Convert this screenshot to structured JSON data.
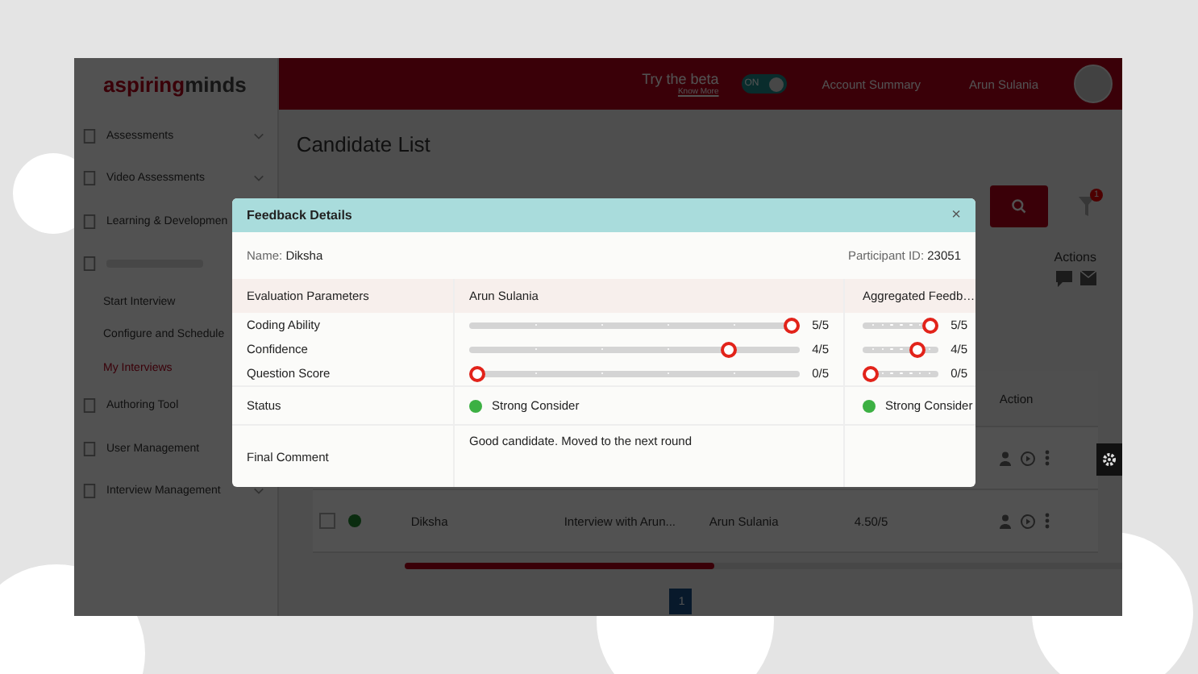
{
  "sidebar": {
    "logo": {
      "light": "aspiring",
      "bold": "minds"
    },
    "items": [
      {
        "label": "Assessments",
        "expandable": true,
        "selected": false
      },
      {
        "label": "Video Assessments",
        "expandable": true,
        "selected": false
      },
      {
        "label": "Learning & Developmen",
        "selected": false
      },
      {
        "disabled": true,
        "expandable": false,
        "children": [
          {
            "label": "Start Interview",
            "selected": false
          },
          {
            "label": "Configure and Schedule",
            "selected": false
          },
          {
            "label": "My Interviews",
            "selected": true
          }
        ]
      },
      {
        "label": "Authoring Tool",
        "selected": false
      },
      {
        "label": "User Management",
        "selected": false
      },
      {
        "label": "Interview Management",
        "expandable": true,
        "selected": false
      }
    ]
  },
  "topbar": {
    "beta": {
      "title": "Try the beta",
      "link": "Know More",
      "toggle": {
        "label": "ON",
        "on": true
      }
    },
    "links": [
      "Account Summary",
      "Arun Sulania"
    ]
  },
  "page": {
    "title": "Candidate List",
    "filter_badge": "1",
    "actions_label": "Actions",
    "table": {
      "action_header": "Action",
      "rows": [
        {
          "kind": "covered"
        },
        {
          "kind": "full",
          "checked": false,
          "color": "#0a2c0f",
          "name": "Diksha",
          "interview": "Interview with Arun...",
          "interviewer": "Arun Sulania",
          "score": "4.50/5"
        }
      ]
    },
    "scrollbar": {
      "level": 0.4
    },
    "pages": [
      {
        "label": "1",
        "selected": true
      }
    ]
  },
  "modal": {
    "title": "Feedback Details",
    "close": "×",
    "name_label": "Name:",
    "name": "Diksha",
    "participant_label": "Participant ID:",
    "participant_id": "23051",
    "columns": [
      "Evaluation Parameters",
      "Arun Sulania",
      "Aggregated Feedb…"
    ],
    "parameters": [
      {
        "name": "Coding Ability",
        "rating": {
          "level": 1,
          "reading": "5/5"
        },
        "aggregate": {
          "level": 1,
          "reading": "5/5"
        }
      },
      {
        "name": "Confidence",
        "rating": {
          "level": 0.8,
          "reading": "4/5"
        },
        "aggregate": {
          "level": 0.8,
          "reading": "4/5"
        }
      },
      {
        "name": "Question Score",
        "rating": {
          "level": 0,
          "reading": "0/5"
        },
        "aggregate": {
          "level": 0,
          "reading": "0/5"
        }
      }
    ],
    "status": {
      "label": "Status",
      "cells": [
        {
          "text": "Strong Consider",
          "color": "#3cb043"
        },
        {
          "text": "Strong Consider",
          "color": "#3cb043"
        }
      ]
    },
    "final_comment": {
      "label": "Final Comment",
      "text": "Good candidate. Moved to the next round"
    }
  }
}
